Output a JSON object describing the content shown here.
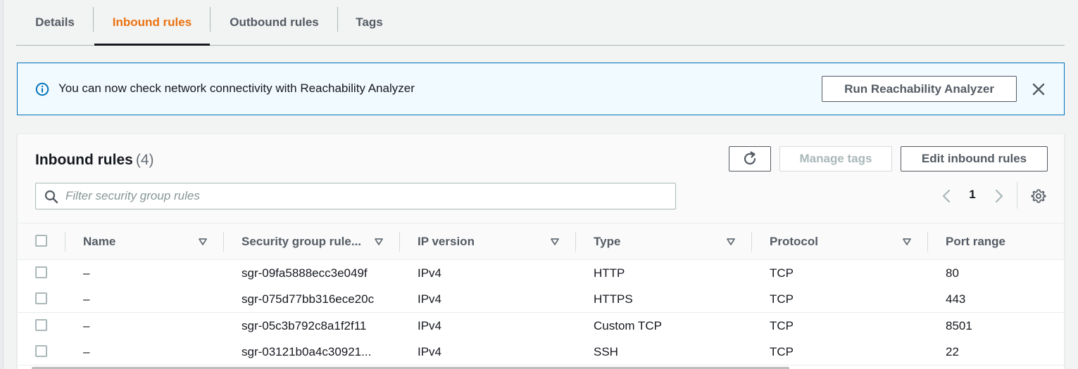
{
  "tabs": [
    {
      "label": "Details",
      "active": false
    },
    {
      "label": "Inbound rules",
      "active": true
    },
    {
      "label": "Outbound rules",
      "active": false
    },
    {
      "label": "Tags",
      "active": false
    }
  ],
  "banner": {
    "icon": "info-icon",
    "message": "You can now check network connectivity with Reachability Analyzer",
    "action_label": "Run Reachability Analyzer",
    "close_icon": "close-icon"
  },
  "rules_panel": {
    "title": "Inbound rules",
    "count": "(4)",
    "refresh_icon": "refresh-icon",
    "manage_tags_label": "Manage tags",
    "edit_label": "Edit inbound rules",
    "filter_placeholder": "Filter security group rules",
    "filter_value": "",
    "page_number": "1",
    "settings_icon": "gear-icon"
  },
  "table": {
    "columns": [
      "Name",
      "Security group rule...",
      "IP version",
      "Type",
      "Protocol",
      "Port range"
    ],
    "rows": [
      {
        "name": "–",
        "rule_id": "sgr-09fa5888ecc3e049f",
        "ip_version": "IPv4",
        "type": "HTTP",
        "protocol": "TCP",
        "port_range": "80"
      },
      {
        "name": "–",
        "rule_id": "sgr-075d77bb316ece20c",
        "ip_version": "IPv4",
        "type": "HTTPS",
        "protocol": "TCP",
        "port_range": "443"
      },
      {
        "name": "–",
        "rule_id": "sgr-05c3b792c8a1f2f11",
        "ip_version": "IPv4",
        "type": "Custom TCP",
        "protocol": "TCP",
        "port_range": "8501"
      },
      {
        "name": "–",
        "rule_id": "sgr-03121b0a4c30921...",
        "ip_version": "IPv4",
        "type": "SSH",
        "protocol": "TCP",
        "port_range": "22"
      }
    ]
  },
  "colors": {
    "accent_active_tab": "#ec7211",
    "info_border": "#0073bb",
    "info_background": "#f1faff"
  }
}
